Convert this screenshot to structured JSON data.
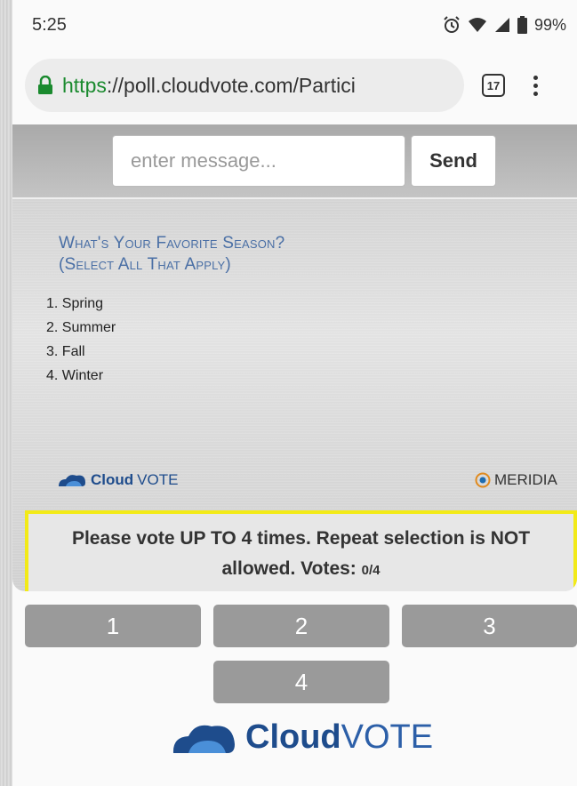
{
  "status_bar": {
    "time": "5:25",
    "battery": "99%",
    "icons": [
      "alarm-icon",
      "wifi-icon",
      "signal-icon",
      "battery-icon"
    ]
  },
  "browser": {
    "url_scheme": "https",
    "url_rest": "://poll.cloudvote.com/Partici",
    "tab_count": "17",
    "lock_color": "#1a8a2e"
  },
  "message_bar": {
    "placeholder": "enter message...",
    "send_label": "Send"
  },
  "slide": {
    "question_line1": "What's Your Favorite Season?",
    "question_line2": "(Select All That Apply)",
    "options": [
      "1.  Spring",
      "2.  Summer",
      "3.  Fall",
      "4.  Winter"
    ],
    "brand_left_bold": "Cloud",
    "brand_left_light": "VOTE",
    "brand_right": "MERIDIA"
  },
  "notice": {
    "text": "Please vote UP TO 4 times. Repeat selection is NOT allowed. Votes: ",
    "votes": "0/4",
    "highlight_color": "#f2ea18"
  },
  "vote_buttons": [
    "1",
    "2",
    "3",
    "4"
  ],
  "footer": {
    "brand_bold": "Cloud",
    "brand_light": "VOTE"
  },
  "colors": {
    "accent": "#1e4c8c",
    "question": "#4a6fa5",
    "button": "#9a9a9a"
  }
}
